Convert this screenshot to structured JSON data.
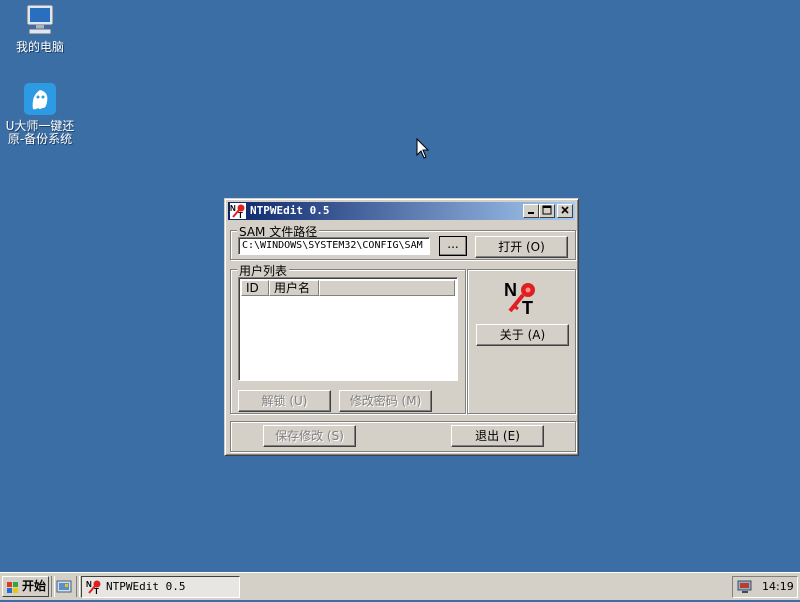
{
  "desktop": {
    "icons": [
      {
        "label": "我的电脑",
        "icon": "my-computer-icon"
      },
      {
        "label": "U大师一键还\n原-备份系统",
        "icon": "ghost-icon"
      }
    ]
  },
  "window": {
    "title": "NTPWEdit 0.5",
    "sam_group_label": "SAM 文件路径",
    "sam_path": "C:\\WINDOWS\\SYSTEM32\\CONFIG\\SAM",
    "browse_label": "...",
    "open_label": "打开 (O)",
    "users_group_label": "用户列表",
    "columns": [
      "ID",
      "用户名"
    ],
    "about_label": "关于 (A)",
    "unlock_label": "解锁 (U)",
    "change_password_label": "修改密码 (M)",
    "save_label": "保存修改 (S)",
    "exit_label": "退出 (E)"
  },
  "taskbar": {
    "start_label": "开始",
    "task_label": "NTPWEdit 0.5",
    "clock": "14:19"
  }
}
